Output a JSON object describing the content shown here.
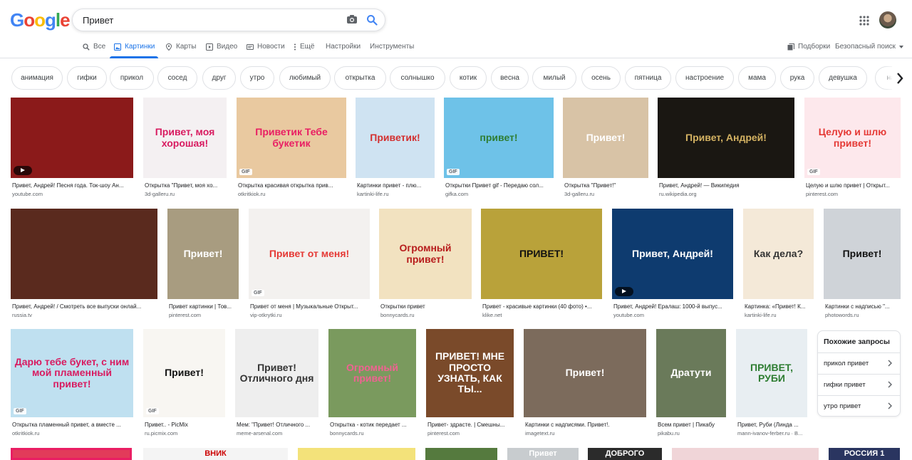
{
  "header": {
    "logo_letters": [
      "G",
      "o",
      "o",
      "g",
      "l",
      "e"
    ],
    "logo_colors": [
      "#4285f4",
      "#ea4335",
      "#fbbc05",
      "#4285f4",
      "#34a853",
      "#ea4335"
    ],
    "search_value": "Привет"
  },
  "nav": {
    "items": [
      {
        "label": "Все",
        "icon": "search-icon"
      },
      {
        "label": "Картинки",
        "icon": "image-icon",
        "active": true
      },
      {
        "label": "Карты",
        "icon": "map-pin-icon"
      },
      {
        "label": "Видео",
        "icon": "video-icon"
      },
      {
        "label": "Новости",
        "icon": "news-icon"
      },
      {
        "label": "Ещё",
        "icon": "more-vert-icon"
      },
      {
        "label": "Настройки"
      },
      {
        "label": "Инструменты"
      }
    ],
    "collections_label": "Подборки",
    "safesearch_label": "Безопасный поиск"
  },
  "chips": [
    "анимация",
    "гифки",
    "прикол",
    "сосед",
    "друг",
    "утро",
    "любимый",
    "открытка",
    "солнышко",
    "котик",
    "весна",
    "милый",
    "осень",
    "пятница",
    "настроение",
    "мама",
    "рука",
    "девушка",
    "натал"
  ],
  "results": [
    {
      "title": "Привет, Андрей! Песня года. Ток-шоу Ан...",
      "source": "youtube.com",
      "caption": "",
      "bg": "#8b1a1a",
      "fg": "#fff",
      "badge": "video"
    },
    {
      "title": "Открытка \"Привет, моя хо...",
      "source": "3d-galleru.ru",
      "caption": "Привет, моя хорошая!",
      "bg": "#f4f0f2",
      "fg": "#d81b60",
      "badge": ""
    },
    {
      "title": "Открытка красивая открытка прив...",
      "source": "otkritkiok.ru",
      "caption": "Приветик Тебе букетик",
      "bg": "#e9c9a0",
      "fg": "#e91e63",
      "badge": "gif"
    },
    {
      "title": "Картинки привет - плю...",
      "source": "kartinki-life.ru",
      "caption": "Приветик!",
      "bg": "#cfe3f2",
      "fg": "#d32f2f",
      "badge": ""
    },
    {
      "title": "Открытки Привет gif - Передаю сол...",
      "source": "gifka.com",
      "caption": "привет!",
      "bg": "#6ec2e8",
      "fg": "#2e7d32",
      "badge": "gif"
    },
    {
      "title": "Открытка \"Привет!\"",
      "source": "3d-galleru.ru",
      "caption": "Привет!",
      "bg": "#d8c3a6",
      "fg": "#fff",
      "badge": ""
    },
    {
      "title": "Привет, Андрей! — Википедия",
      "source": "ru.wikipedia.org",
      "caption": "Привет, Андрей!",
      "bg": "#1a1712",
      "fg": "#d4b262",
      "badge": ""
    },
    {
      "title": "Целую и шлю привет | Открыт...",
      "source": "pinterest.com",
      "caption": "Целую и шлю привет!",
      "bg": "#fde8ec",
      "fg": "#e53935",
      "badge": "gif"
    },
    {
      "title": "Привет, Андрей! / Смотреть все выпуски онлай...",
      "source": "russia.tv",
      "caption": "",
      "bg": "#5a2a1e",
      "fg": "#fff",
      "badge": ""
    },
    {
      "title": "Привет картинки | Тов...",
      "source": "pinterest.com",
      "caption": "Привет!",
      "bg": "#a89c80",
      "fg": "#fff",
      "badge": ""
    },
    {
      "title": "Привет от меня | Музыкальные Открыт...",
      "source": "vip-otkrytki.ru",
      "caption": "Привет от меня!",
      "bg": "#f3f1ef",
      "fg": "#e53935",
      "badge": "gif"
    },
    {
      "title": "Открытки привет",
      "source": "bonnycards.ru",
      "caption": "Огромный привет!",
      "bg": "#f2e2c0",
      "fg": "#b71c1c",
      "badge": ""
    },
    {
      "title": "Привет - красивые картинки (40 фото) •...",
      "source": "klike.net",
      "caption": "ПРИВЕТ!",
      "bg": "#b9a23a",
      "fg": "#111",
      "badge": ""
    },
    {
      "title": "Привет, Андрей! Ералаш: 1000-й выпус...",
      "source": "youtube.com",
      "caption": "Привет, Андрей!",
      "bg": "#0e3b6f",
      "fg": "#fff",
      "badge": "video"
    },
    {
      "title": "Картинка: «Привет! К...",
      "source": "kartinki-life.ru",
      "caption": "Как дела?",
      "bg": "#f4e9d8",
      "fg": "#333",
      "badge": ""
    },
    {
      "title": "Картинки с надписью \"...",
      "source": "photowords.ru",
      "caption": "Привет!",
      "bg": "#cfd3d8",
      "fg": "#111",
      "badge": ""
    },
    {
      "title": "Открытка пламенный привет, а вместе ...",
      "source": "otkritkiok.ru",
      "caption": "Дарю тебе букет, с ним мой пламенный привет!",
      "bg": "#bfe0f0",
      "fg": "#d81b60",
      "badge": "gif"
    },
    {
      "title": "Привет.. - PicMix",
      "source": "ru.picmix.com",
      "caption": "Привет!",
      "bg": "#f8f6f2",
      "fg": "#111",
      "badge": "gif"
    },
    {
      "title": "Мем: \"Привет! Отличного ...",
      "source": "meme-arsenal.com",
      "caption": "Привет! Отличного дня",
      "bg": "#eeeeee",
      "fg": "#333",
      "badge": ""
    },
    {
      "title": "Открытка - котик передает ...",
      "source": "bonnycards.ru",
      "caption": "Огромный привет!",
      "bg": "#7a9a5e",
      "fg": "#f06292",
      "badge": ""
    },
    {
      "title": "Привет- здрасте. | Смешны...",
      "source": "pinterest.com",
      "caption": "ПРИВЕТ! МНЕ ПРОСТО УЗНАТЬ, КАК ТЫ...",
      "bg": "#7a4a2a",
      "fg": "#fff",
      "badge": ""
    },
    {
      "title": "Картинки с надписями. Привет!.",
      "source": "imagetext.ru",
      "caption": "Привет!",
      "bg": "#7c6b5c",
      "fg": "#fff",
      "badge": ""
    },
    {
      "title": "Всем привет | Пикабу",
      "source": "pikabu.ru",
      "caption": "Дратути",
      "bg": "#6a7a5a",
      "fg": "#fff",
      "badge": ""
    },
    {
      "title": "Привет, Руби (Линда ...",
      "source": "mann-ivanov-ferber.ru · В...",
      "caption": "ПРИВЕТ, РУБИ",
      "bg": "#e8eef2",
      "fg": "#2e7d32",
      "badge": ""
    }
  ],
  "bottom_row": [
    {
      "bg": "#e23b5a",
      "caption": ""
    },
    {
      "bg": "#f4f4f4",
      "caption": "ВНИК"
    },
    {
      "bg": "#f3e27a",
      "caption": ""
    },
    {
      "bg": "#557a3e",
      "caption": ""
    },
    {
      "bg": "#c8cccf",
      "caption": "Привет"
    },
    {
      "bg": "#2b2b2b",
      "caption": "ДОБРОГО"
    },
    {
      "bg": "#f0d5d8",
      "caption": ""
    },
    {
      "bg": "#2a3560",
      "caption": "РОССИЯ 1"
    }
  ],
  "related": {
    "title": "Похожие запросы",
    "items": [
      "прикол привет",
      "гифки привет",
      "утро привет"
    ]
  }
}
